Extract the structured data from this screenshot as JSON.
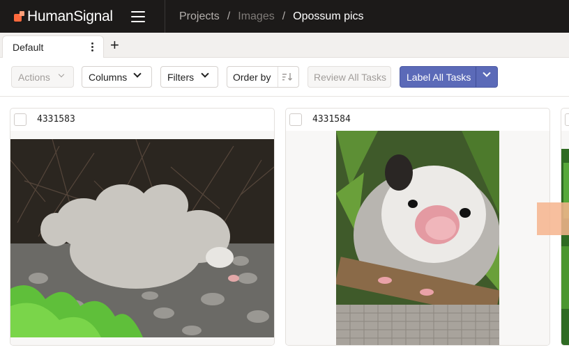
{
  "app": {
    "brand": "HumanSignal",
    "breadcrumb": [
      "Projects",
      "Images",
      "Opossum pics"
    ],
    "separator": "/"
  },
  "tabs": [
    {
      "label": "Default"
    }
  ],
  "toolbar": {
    "actions_label": "Actions",
    "columns_label": "Columns",
    "filters_label": "Filters",
    "order_label": "Order by",
    "review_label": "Review All Tasks",
    "label_all_label": "Label All Tasks"
  },
  "tasks": [
    {
      "id": "4331583",
      "image": "opossum-mother-with-babies",
      "checked": false
    },
    {
      "id": "4331584",
      "image": "opossum-closeup",
      "checked": false
    },
    {
      "id": "",
      "image": "green-foliage",
      "checked": false
    }
  ],
  "colors": {
    "topbar": "#1c1a19",
    "accent": "#5b6ab8",
    "brand_orange": "#ff6a3d"
  }
}
